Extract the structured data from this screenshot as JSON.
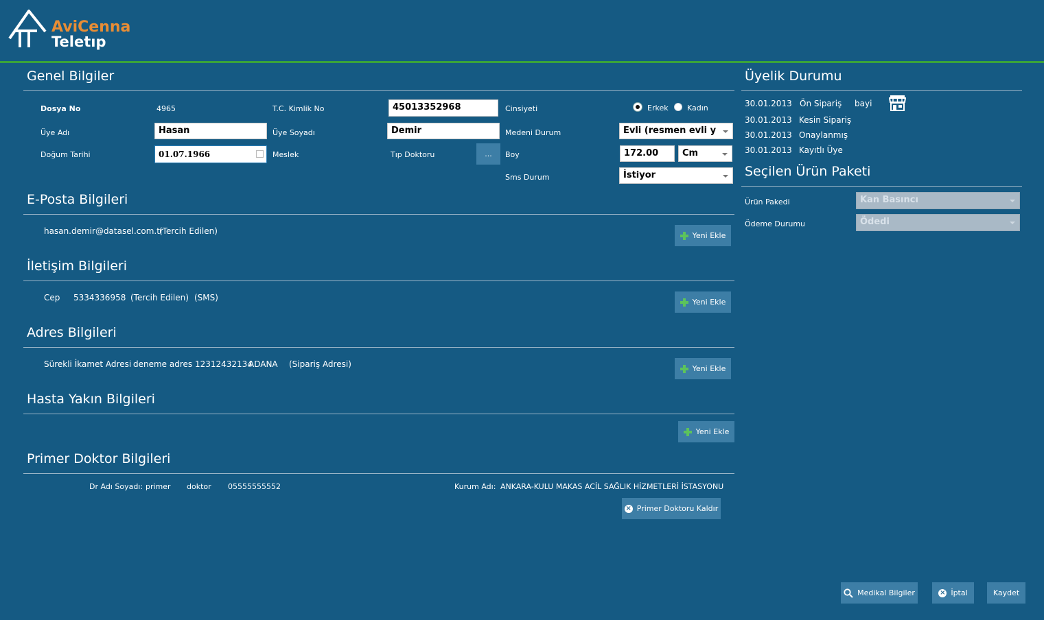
{
  "app": {
    "logo_line1": "AviCenna",
    "logo_line2": "Teletıp",
    "accent": "#e88d35",
    "bg": "#155a83",
    "header_line": "#3aa33a"
  },
  "genel": {
    "title": "Genel Bilgiler",
    "dosya_no_label": "Dosya No",
    "dosya_no": "4965",
    "tc_label": "T.C. Kimlik No",
    "tc": "45013352968",
    "cinsiyet_label": "Cinsiyeti",
    "erkek": "Erkek",
    "kadin": "Kadın",
    "selected_gender": "Erkek",
    "uye_adi_label": "Üye Adı",
    "uye_adi": "Hasan",
    "uye_soyadi_label": "Üye Soyadı",
    "uye_soyadi": "Demir",
    "medeni_label": "Medeni Durum",
    "medeni": "Evli (resmen evli y",
    "dogum_label": "Doğum Tarihi",
    "dogum": "01.07.1966",
    "meslek_label": "Meslek",
    "meslek": "Tıp Doktoru",
    "meslek_btn": "...",
    "boy_label": "Boy",
    "boy": "172.00",
    "boy_unit": "Cm",
    "sms_label": "Sms Durum",
    "sms": "İstiyor"
  },
  "eposta": {
    "title": "E-Posta Bilgileri",
    "email": "hasan.demir@datasel.com.tr",
    "pref": "(Tercih Edilen)",
    "add": "Yeni Ekle"
  },
  "iletisim": {
    "title": "İletişim Bilgileri",
    "type": "Cep",
    "phone": "5334336958",
    "pref": "(Tercih Edilen)",
    "sms": "(SMS)",
    "add": "Yeni Ekle"
  },
  "adres": {
    "title": "Adres Bilgileri",
    "type": "Sürekli İkamet Adresi",
    "addr": "deneme adres 12312432134",
    "city": "ADANA",
    "note": "(Sipariş Adresi)",
    "add": "Yeni Ekle"
  },
  "yakin": {
    "title": "Hasta Yakın Bilgileri",
    "add": "Yeni Ekle"
  },
  "primer": {
    "title": "Primer Doktor Bilgileri",
    "dr_label": "Dr Adı Soyadı:",
    "dr_first": "primer",
    "dr_last": "doktor",
    "dr_phone": "05555555552",
    "kurum_label": "Kurum Adı:",
    "kurum": "ANKARA-KULU MAKAS ACİL SAĞLIK HİZMETLERİ İSTASYONU",
    "remove": "Primer Doktoru Kaldır"
  },
  "uyelik": {
    "title": "Üyelik Durumu",
    "rows": [
      {
        "date": "30.01.2013",
        "status": "Ön Sipariş",
        "extra": "bayi"
      },
      {
        "date": "30.01.2013",
        "status": "Kesin Sipariş",
        "extra": ""
      },
      {
        "date": "30.01.2013",
        "status": "Onaylanmış",
        "extra": ""
      },
      {
        "date": "30.01.2013",
        "status": "Kayıtlı Üye",
        "extra": ""
      }
    ]
  },
  "paket": {
    "title": "Seçilen Ürün Paketi",
    "urun_label": "Ürün Pakedi",
    "urun": "Kan Basıncı",
    "odeme_label": "Ödeme Durumu",
    "odeme": "Ödedi"
  },
  "footer": {
    "medikal": "Medikal Bilgiler",
    "iptal": "İptal",
    "kaydet": "Kaydet"
  }
}
